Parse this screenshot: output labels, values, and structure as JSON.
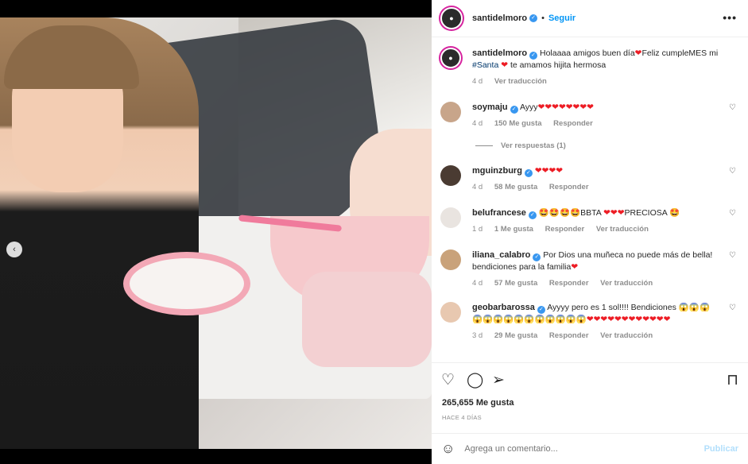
{
  "post": {
    "username": "santidelmoro",
    "follow_label": "Seguir",
    "more_label": "•••",
    "separator": "•"
  },
  "caption": {
    "username": "santidelmoro",
    "text_1": "Holaaaa amigos buen día",
    "text_2": "Feliz cumpleMES mi",
    "hashtag": "#Santa",
    "text_3": "te amamos hijita hermosa",
    "time": "4 d",
    "translate": "Ver traducción"
  },
  "comments": [
    {
      "username": "soymaju",
      "text": "Ayyy",
      "hearts": "❤❤❤❤❤❤❤❤",
      "time": "4 d",
      "likes": "150 Me gusta",
      "reply": "Responder",
      "translate": ""
    },
    {
      "username": "mguinzburg",
      "text": "",
      "hearts": "❤❤❤❤",
      "time": "4 d",
      "likes": "58 Me gusta",
      "reply": "Responder",
      "translate": ""
    },
    {
      "username": "belufrancese",
      "text_a": "🤩🤩🤩🤩BBTA",
      "hearts_a": "❤❤❤",
      "text_b": "PRECIOSA 🤩",
      "time": "1 d",
      "likes": "1 Me gusta",
      "reply": "Responder",
      "translate": "Ver traducción"
    },
    {
      "username": "iliana_calabro",
      "text": "Por Dios una muñeca no puede más de bella! bendiciones para la familia",
      "hearts": "❤",
      "time": "4 d",
      "likes": "57 Me gusta",
      "reply": "Responder",
      "translate": "Ver traducción"
    },
    {
      "username": "geobarbarossa",
      "text": "Ayyyy pero es 1 sol!!!! Bendiciones",
      "emojis": "😱😱😱 😱😱😱😱😱😱😱😱😱😱😱",
      "hearts": "❤❤❤❤❤❤❤❤❤❤❤❤",
      "time": "3 d",
      "likes": "29 Me gusta",
      "reply": "Responder",
      "translate": "Ver traducción"
    }
  ],
  "replies_label": "Ver respuestas (1)",
  "likes_count": "265,655 Me gusta",
  "date_label": "HACE 4 DÍAS",
  "add_comment_placeholder": "Agrega un comentario...",
  "publish_label": "Publicar",
  "icons": [
    "heart-icon",
    "comment-icon",
    "share-icon",
    "bookmark-icon",
    "emoji-icon",
    "verified-icon",
    "chevron-left-icon"
  ],
  "colors": {
    "accent": "#0095f6",
    "heart": "#ed1c24",
    "verified": "#3897f0"
  }
}
